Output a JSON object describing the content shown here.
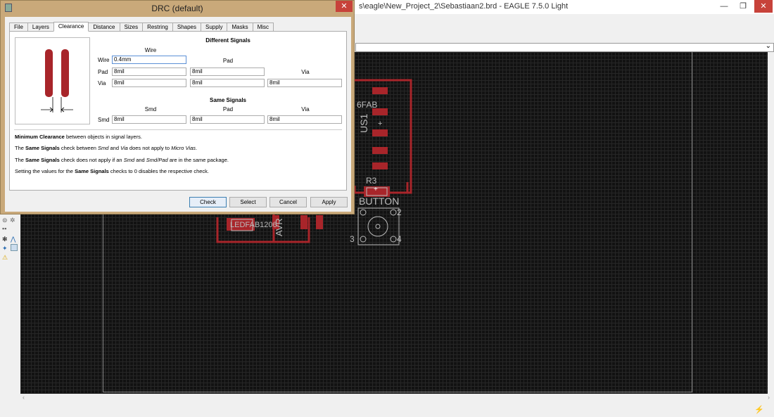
{
  "window": {
    "title": "s\\eagle\\New_Project_2\\Sebastiaan2.brd - EAGLE 7.5.0 Light",
    "minimize_glyph": "—",
    "maximize_glyph": "❐",
    "close_glyph": "✕"
  },
  "dialog": {
    "title": "DRC (default)",
    "close_glyph": "✕",
    "tabs": [
      "File",
      "Layers",
      "Clearance",
      "Distance",
      "Sizes",
      "Restring",
      "Shapes",
      "Supply",
      "Masks",
      "Misc"
    ],
    "active_tab": "Clearance",
    "different_signals": {
      "header": "Different Signals",
      "columns": [
        "Wire",
        "Pad",
        "Via"
      ],
      "rows": [
        {
          "label": "Wire",
          "values": [
            "0.4mm"
          ]
        },
        {
          "label": "Pad",
          "values": [
            "8mil",
            "8mil"
          ]
        },
        {
          "label": "Via",
          "values": [
            "8mil",
            "8mil",
            "8mil"
          ]
        }
      ]
    },
    "same_signals": {
      "header": "Same Signals",
      "columns": [
        "Smd",
        "Pad",
        "Via"
      ],
      "rows": [
        {
          "label": "Smd",
          "values": [
            "8mil",
            "8mil",
            "8mil"
          ]
        }
      ]
    },
    "notes": {
      "n1_bold": "Minimum Clearance",
      "n1_rest": " between objects in signal layers.",
      "n2_a": "The ",
      "n2_b": "Same Signals",
      "n2_c": " check between ",
      "n2_d": "Smd",
      "n2_e": " and ",
      "n2_f": "Via",
      "n2_g": " does not apply to ",
      "n2_h": "Micro Vias",
      "n2_i": ".",
      "n3_a": "The ",
      "n3_b": "Same Signals",
      "n3_c": " check does not apply if an ",
      "n3_d": "Smd",
      "n3_e": " and ",
      "n3_f": "Smd/Pad",
      "n3_g": " are in the same package.",
      "n4_a": "Setting the values for the ",
      "n4_b": "Same Signals",
      "n4_c": " checks to 0 disables the respective check."
    },
    "buttons": {
      "check": "Check",
      "select": "Select",
      "cancel": "Cancel",
      "apply": "Apply"
    }
  },
  "board": {
    "labels": {
      "fab": "6FAB",
      "us1": "US1",
      "r3": "R3",
      "button": "BUTTON",
      "pin2": "2",
      "pin3": "3",
      "pin4": "4",
      "ledfab": "LEDFAB1206",
      "avr": "AVR",
      "plus1": "+",
      "plus2": "+"
    },
    "trace_color": "#a8252a",
    "pad_color": "#a8252a"
  }
}
